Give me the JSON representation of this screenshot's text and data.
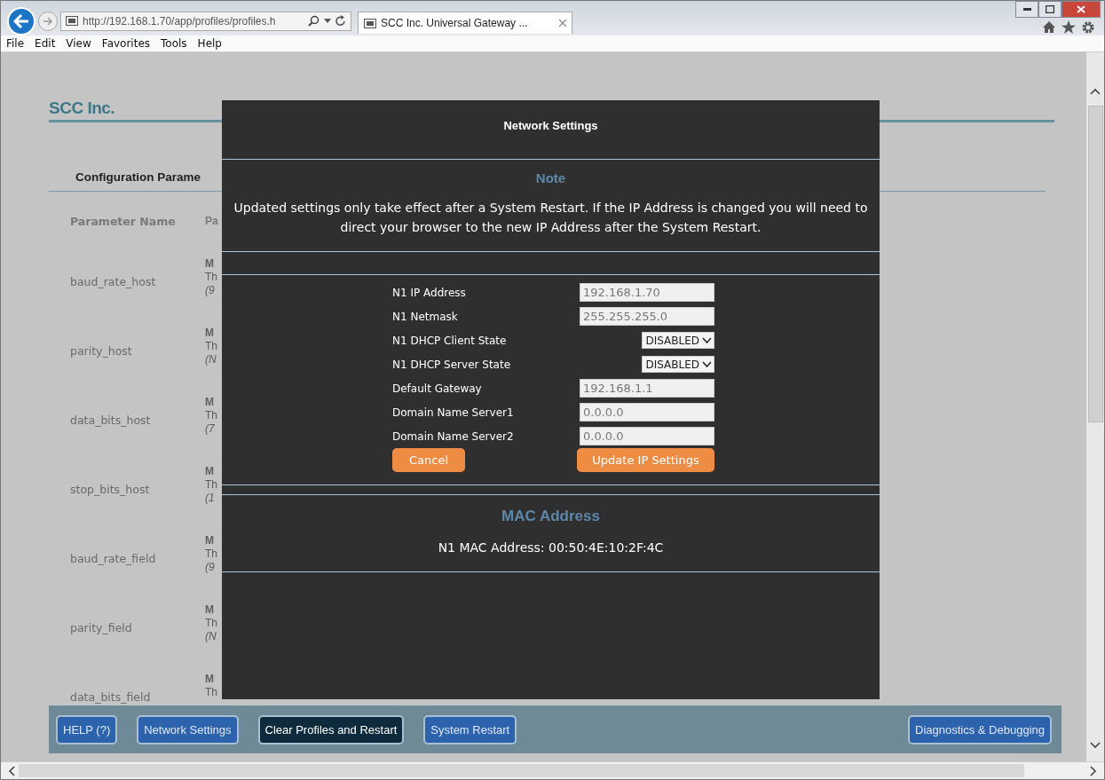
{
  "browser": {
    "url": "http://192.168.1.70/app/profiles/profiles.h",
    "tab_title": "SCC Inc. Universal Gateway ...",
    "menu": [
      "File",
      "Edit",
      "View",
      "Favorites",
      "Tools",
      "Help"
    ]
  },
  "page": {
    "logo": "SCC Inc.",
    "section_title": "Configuration Parame",
    "columns": [
      "Parameter Name",
      "Pa"
    ],
    "rows": [
      {
        "name": "baud_rate_host",
        "title": "M",
        "description": "Th",
        "hint": "(9"
      },
      {
        "name": "parity_host",
        "title": "M",
        "description": "Th",
        "hint": "(N"
      },
      {
        "name": "data_bits_host",
        "title": "M",
        "description": "Th",
        "hint": "(7"
      },
      {
        "name": "stop_bits_host",
        "title": "M",
        "description": "Th",
        "hint": "(1"
      },
      {
        "name": "baud_rate_field",
        "title": "M",
        "description": "Th",
        "hint": "(9"
      },
      {
        "name": "parity_field",
        "title": "M",
        "description": "Th",
        "hint": "(N"
      },
      {
        "name": "data_bits_field",
        "title": "M",
        "description": "Th"
      }
    ],
    "buttons_left": [
      {
        "label": "HELP (?)",
        "selected": false
      },
      {
        "label": "Network Settings",
        "selected": false
      },
      {
        "label": "Clear Profiles and Restart",
        "selected": true
      },
      {
        "label": "System Restart",
        "selected": false
      }
    ],
    "buttons_right": [
      {
        "label": "Diagnostics & Debugging",
        "selected": false
      }
    ]
  },
  "modal": {
    "title": "Network Settings",
    "note_heading": "Note",
    "note": "Updated settings only take effect after a System Restart. If the IP Address is changed you will need to direct your browser to the new IP Address after the System Restart.",
    "fields": [
      {
        "kind": "input",
        "label": "N1 IP Address",
        "value": "192.168.1.70"
      },
      {
        "kind": "input",
        "label": "N1 Netmask",
        "value": "255.255.255.0"
      },
      {
        "kind": "select",
        "label": "N1 DHCP Client State",
        "value": "DISABLED"
      },
      {
        "kind": "select",
        "label": "N1 DHCP Server State",
        "value": "DISABLED"
      },
      {
        "kind": "input",
        "label": "Default Gateway",
        "value": "192.168.1.1"
      },
      {
        "kind": "input",
        "label": "Domain Name Server1",
        "value": "0.0.0.0"
      },
      {
        "kind": "input",
        "label": "Domain Name Server2",
        "value": "0.0.0.0"
      }
    ],
    "cancel": "Cancel",
    "update": "Update IP Settings",
    "mac_heading": "MAC Address",
    "mac": "N1 MAC Address: 00:50:4E:10:2F:4C"
  }
}
